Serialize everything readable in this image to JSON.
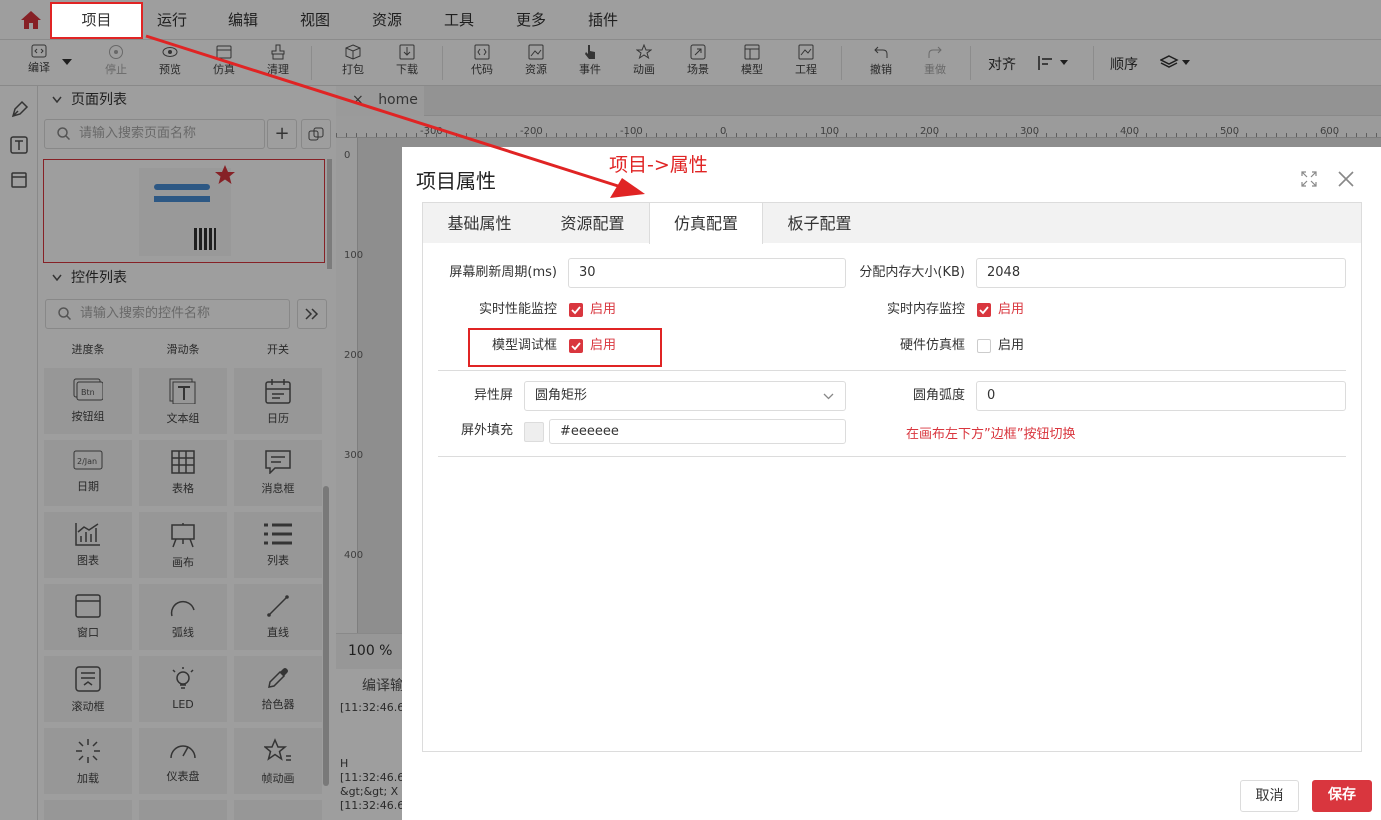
{
  "menu": {
    "items": [
      "项目",
      "运行",
      "编辑",
      "视图",
      "资源",
      "工具",
      "更多",
      "插件"
    ]
  },
  "toolbar": {
    "buttons": [
      "编译",
      "停止",
      "预览",
      "仿真",
      "清理",
      "打包",
      "下载",
      "代码",
      "资源",
      "事件",
      "动画",
      "场景",
      "模型",
      "工程",
      "撤销",
      "重做"
    ],
    "align_label": "对齐",
    "order_label": "顺序"
  },
  "pages": {
    "title": "页面列表",
    "search_placeholder": "请输入搜索页面名称"
  },
  "widgets": {
    "title": "控件列表",
    "search_placeholder": "请输入搜索的控件名称",
    "top_row": [
      "进度条",
      "滑动条",
      "开关"
    ],
    "items": [
      "按钮组",
      "文本组",
      "日历",
      "日期",
      "表格",
      "消息框",
      "图表",
      "画布",
      "列表",
      "窗口",
      "弧线",
      "直线",
      "滚动框",
      "LED",
      "拾色器",
      "加载",
      "仪表盘",
      "帧动画"
    ]
  },
  "canvas": {
    "tab_name": "home",
    "tab_close": "×",
    "ruler_top": [
      "-300",
      "-200",
      "-100",
      "0",
      "100",
      "200",
      "300",
      "400",
      "500",
      "600"
    ],
    "ruler_left": [
      "0",
      "100",
      "200",
      "300",
      "400"
    ],
    "zoom": "100 %",
    "log_tab": "编译输",
    "log_lines": [
      "[11:32:46.6",
      "H",
      "[11:32:46.6",
      "&gt;&gt; X",
      "[11:32:46.6"
    ]
  },
  "annotation": {
    "text": "项目->属性",
    "color": "#e02424"
  },
  "dialog": {
    "title": "项目属性",
    "tabs": [
      "基础属性",
      "资源配置",
      "仿真配置",
      "板子配置"
    ],
    "active_tab": "仿真配置",
    "screen_refresh_label": "屏幕刷新周期(ms)",
    "screen_refresh_value": "30",
    "mem_size_label": "分配内存大小(KB)",
    "mem_size_value": "2048",
    "perf_monitor_label": "实时性能监控",
    "mem_monitor_label": "实时内存监控",
    "model_debug_label": "模型调试框",
    "hw_sim_label": "硬件仿真框",
    "enable_text": "启用",
    "shape_label": "异性屏",
    "shape_value": "圆角矩形",
    "radius_label": "圆角弧度",
    "radius_value": "0",
    "fill_label": "屏外填充",
    "fill_value": "#eeeeee",
    "hint": "在画布左下方”边框”按钮切换",
    "cancel": "取消",
    "save": "保存"
  },
  "colors": {
    "accent": "#d9363e",
    "annotation_red": "#e02424",
    "overlay": "rgba(0,0,0,0.38)"
  }
}
